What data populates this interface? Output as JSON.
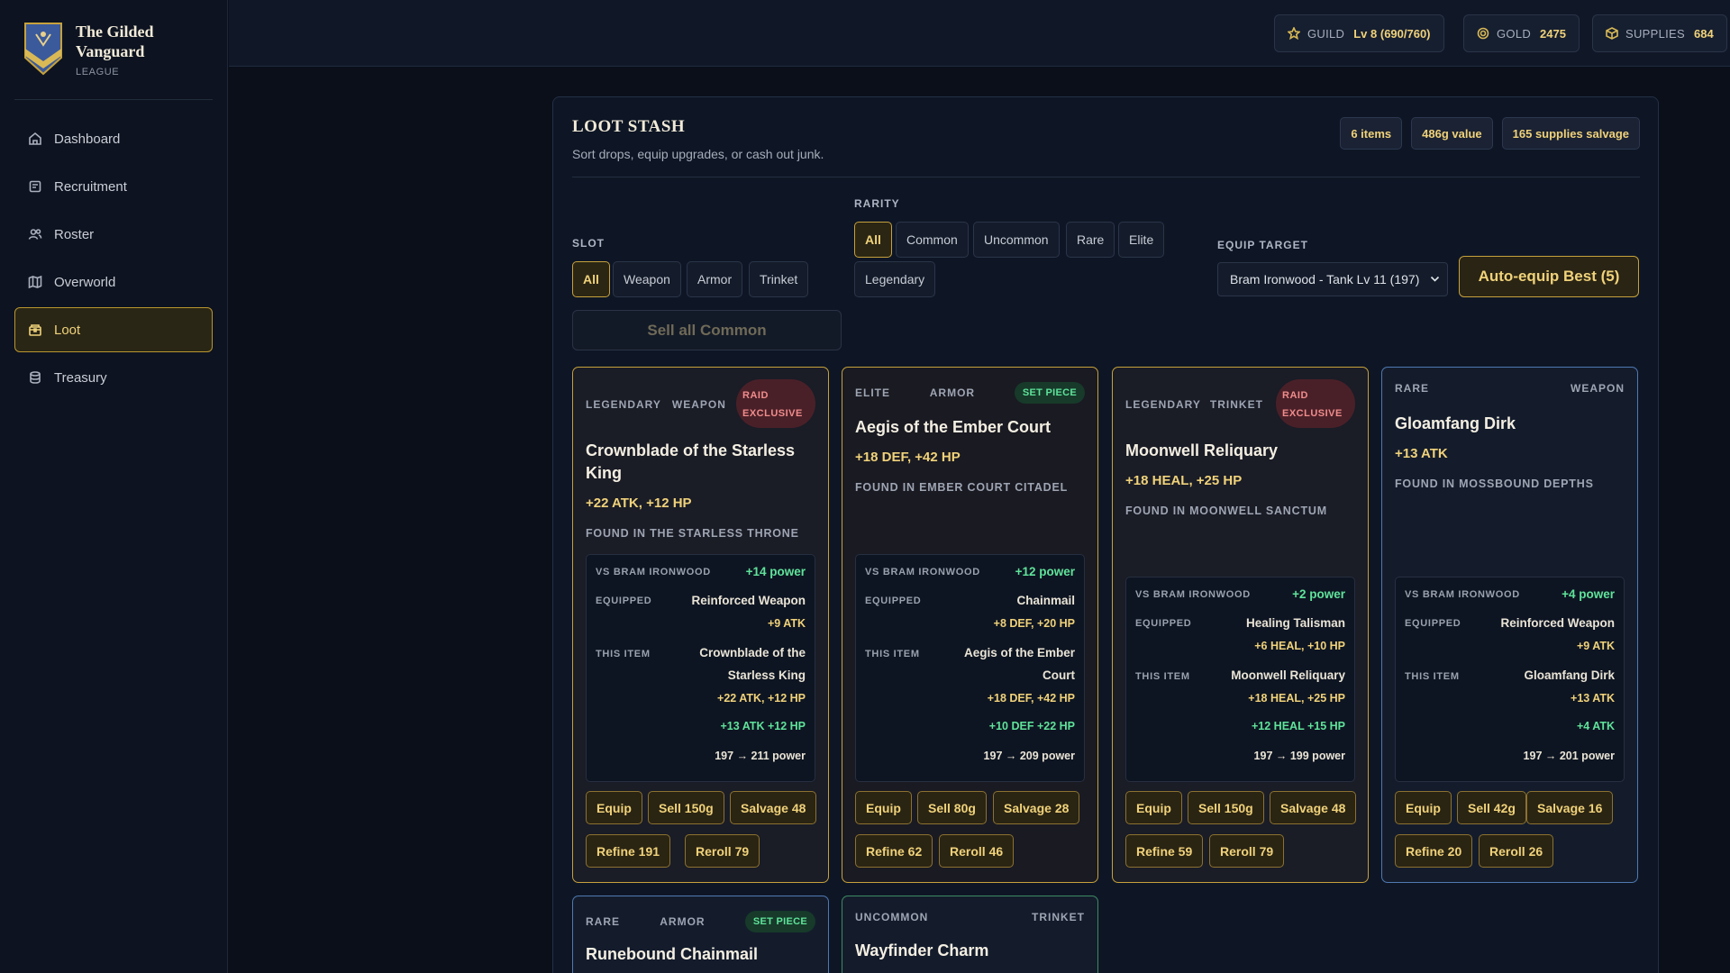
{
  "brand": {
    "title_line1": "The Gilded",
    "title_line2": "Vanguard",
    "subtitle": "LEAGUE"
  },
  "nav": [
    {
      "label": "Dashboard",
      "icon": "home-icon"
    },
    {
      "label": "Recruitment",
      "icon": "clipboard-icon"
    },
    {
      "label": "Roster",
      "icon": "users-icon"
    },
    {
      "label": "Overworld",
      "icon": "map-icon"
    },
    {
      "label": "Loot",
      "icon": "chest-icon",
      "active": true
    },
    {
      "label": "Treasury",
      "icon": "coins-icon"
    }
  ],
  "topbar": {
    "guild_label": "GUILD",
    "guild_value": "Lv 8 (690/760)",
    "gold_label": "GOLD",
    "gold_value": "2475",
    "supplies_label": "SUPPLIES",
    "supplies_value": "684"
  },
  "panel": {
    "title": "LOOT STASH",
    "subtitle": "Sort drops, equip upgrades, or cash out junk.",
    "summary": [
      "6 items",
      "486g value",
      "165 supplies salvage"
    ]
  },
  "filters": {
    "slot_label": "SLOT",
    "slot_options": [
      "All",
      "Weapon",
      "Armor",
      "Trinket"
    ],
    "rarity_label": "RARITY",
    "rarity_options": [
      "All",
      "Common",
      "Uncommon",
      "Rare",
      "Elite",
      "Legendary"
    ],
    "equip_target_label": "EQUIP TARGET",
    "equip_target_value": "Bram Ironwood - Tank Lv 11 (197)",
    "auto_equip": "Auto-equip Best (5)",
    "sell_common": "Sell all Common"
  },
  "compare_labels": {
    "vs": "VS BRAM IRONWOOD",
    "equipped": "EQUIPPED",
    "this_item": "THIS ITEM"
  },
  "cards": [
    {
      "rarity": "LEGENDARY",
      "slot": "WEAPON",
      "badge": "RAID EXCLUSIVE",
      "name": "Crownblade of the Starless King",
      "stats": "+22 ATK, +12 HP",
      "found": "FOUND IN THE STARLESS THRONE",
      "power_delta": "+14 power",
      "equipped_name": "Reinforced Weapon",
      "equipped_stats": "+9 ATK",
      "item_name": "Crownblade of the Starless King",
      "item_stats": "+22 ATK, +12 HP",
      "diff": "+13 ATK  +12 HP",
      "power_change": "197 → 211 power",
      "actions": [
        "Equip",
        "Sell 150g",
        "Salvage 48",
        "Refine 191",
        "Reroll 79"
      ]
    },
    {
      "rarity": "ELITE",
      "slot": "ARMOR",
      "badge": "SET PIECE",
      "name": "Aegis of the Ember Court",
      "stats": "+18 DEF, +42 HP",
      "found": "FOUND IN EMBER COURT CITADEL",
      "power_delta": "+12 power",
      "equipped_name": "Chainmail",
      "equipped_stats": "+8 DEF, +20 HP",
      "item_name": "Aegis of the Ember Court",
      "item_stats": "+18 DEF, +42 HP",
      "diff": "+10 DEF  +22 HP",
      "power_change": "197 → 209 power",
      "actions": [
        "Equip",
        "Sell 80g",
        "Salvage 28",
        "Refine 62",
        "Reroll 46"
      ]
    },
    {
      "rarity": "LEGENDARY",
      "slot": "TRINKET",
      "badge": "RAID EXCLUSIVE",
      "name": "Moonwell Reliquary",
      "stats": "+18 HEAL, +25 HP",
      "found": "FOUND IN MOONWELL SANCTUM",
      "power_delta": "+2 power",
      "equipped_name": "Healing Talisman",
      "equipped_stats": "+6 HEAL, +10 HP",
      "item_name": "Moonwell Reliquary",
      "item_stats": "+18 HEAL, +25 HP",
      "diff": "+12 HEAL  +15 HP",
      "power_change": "197 → 199 power",
      "actions": [
        "Equip",
        "Sell 150g",
        "Salvage 48",
        "Refine 59",
        "Reroll 79"
      ]
    },
    {
      "rarity": "RARE",
      "slot": "WEAPON",
      "badge": "",
      "name": "Gloamfang Dirk",
      "stats": "+13 ATK",
      "found": "FOUND IN MOSSBOUND DEPTHS",
      "power_delta": "+4 power",
      "equipped_name": "Reinforced Weapon",
      "equipped_stats": "+9 ATK",
      "item_name": "Gloamfang Dirk",
      "item_stats": "+13 ATK",
      "diff": "+4 ATK",
      "power_change": "197 → 201 power",
      "actions": [
        "Equip",
        "Sell 42g",
        "Salvage 16",
        "Refine 20",
        "Reroll 26"
      ]
    },
    {
      "rarity": "RARE",
      "slot": "ARMOR",
      "badge": "SET PIECE",
      "name": "Runebound Chainmail"
    },
    {
      "rarity": "UNCOMMON",
      "slot": "TRINKET",
      "badge": "",
      "name": "Wayfinder Charm"
    }
  ],
  "colors": {
    "gold": "#f0d27a",
    "legendary_border": "#c6a13c",
    "rare_border": "#4f79b3",
    "uncommon_border": "#3e8a63",
    "green": "#5fe39a",
    "raid_red": "#f08c8c"
  }
}
